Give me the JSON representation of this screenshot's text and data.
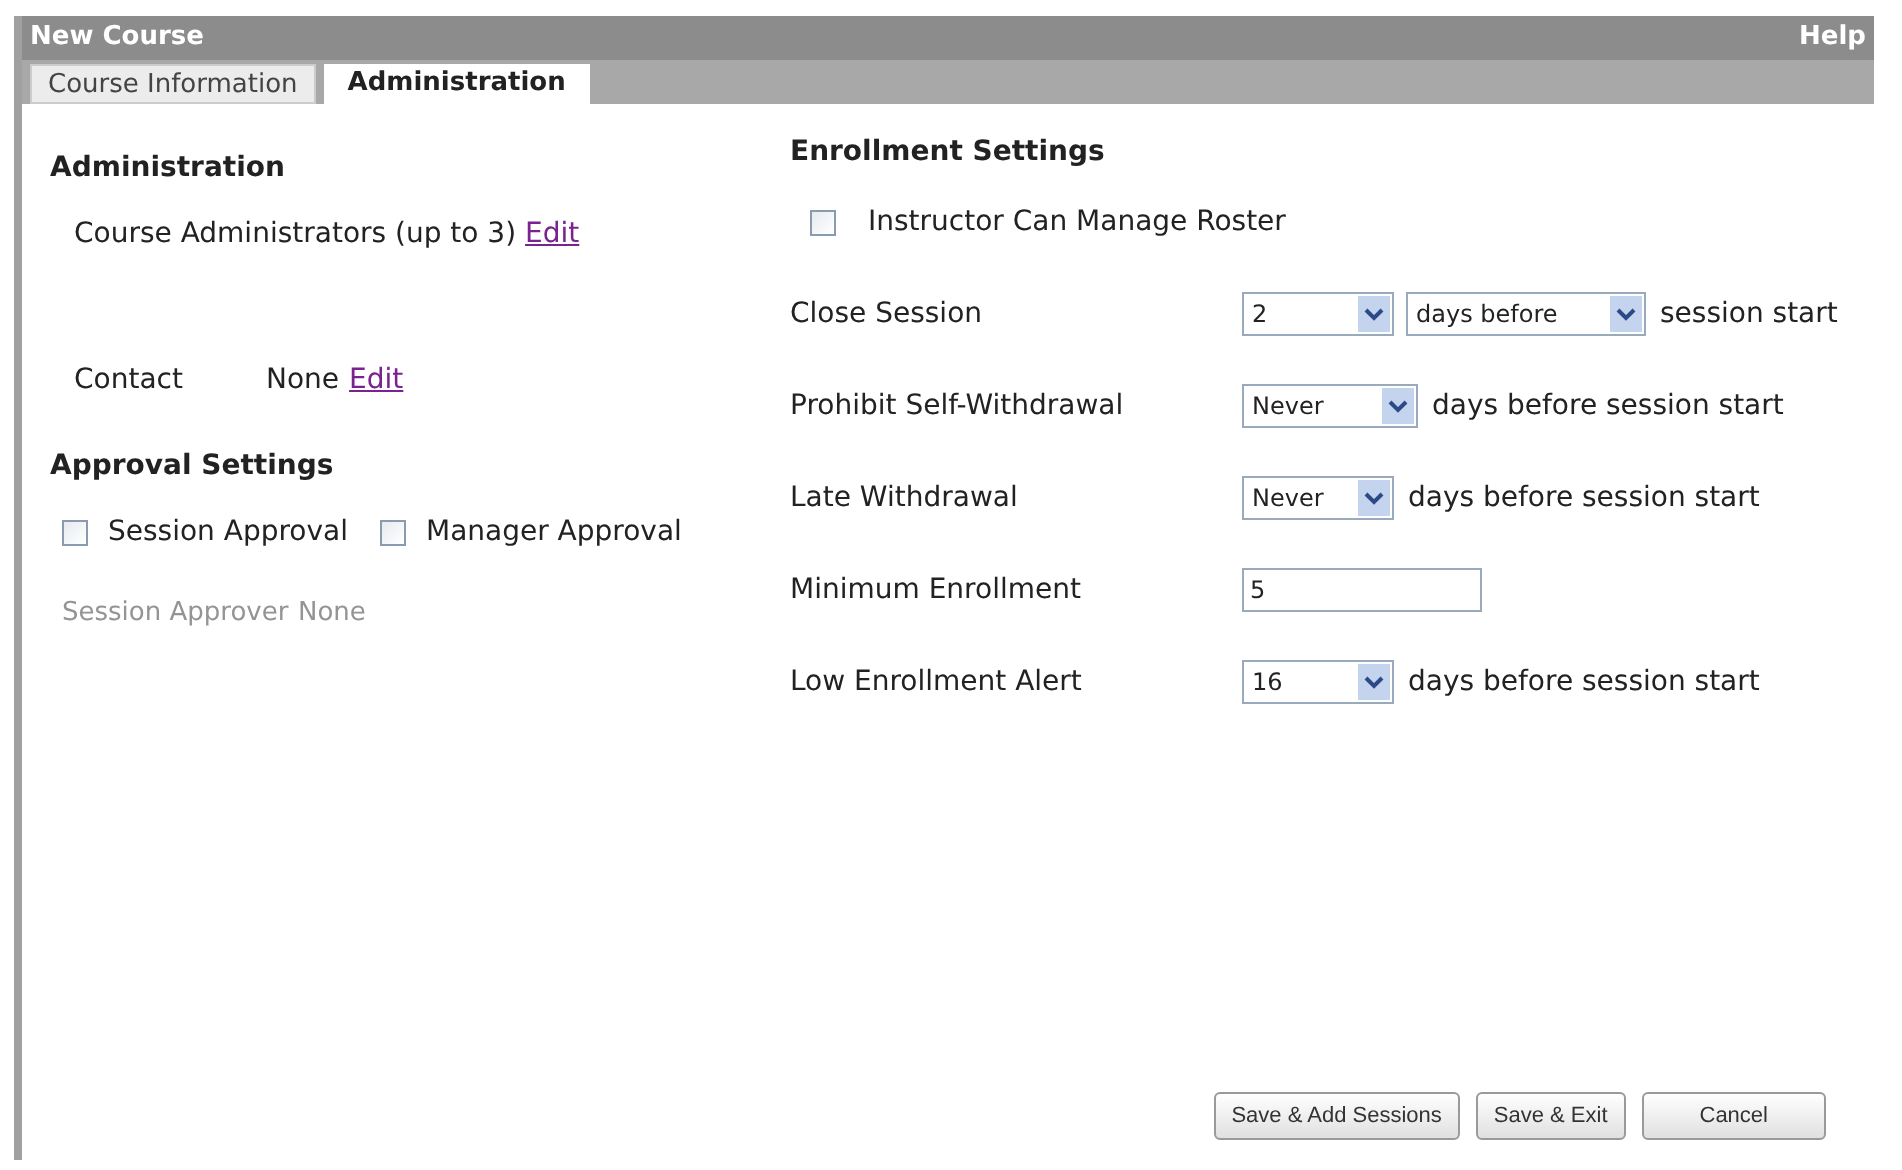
{
  "window": {
    "title": "New Course",
    "help": "Help"
  },
  "tabs": [
    {
      "label": "Course Information",
      "selected": false
    },
    {
      "label": "Administration",
      "selected": true
    }
  ],
  "administration": {
    "heading": "Administration",
    "administrators_label": "Course Administrators (up to 3)",
    "administrators_link": "Edit",
    "contact_label": "Contact",
    "contact_value": "None",
    "contact_link": "Edit"
  },
  "approval": {
    "heading": "Approval Settings",
    "options": [
      {
        "label": "Session Approval",
        "checked": false
      },
      {
        "label": "Manager Approval",
        "checked": false
      }
    ],
    "approver": {
      "label": "Session Approver",
      "value": "None",
      "disabled": true
    }
  },
  "enrollment": {
    "heading": "Enrollment Settings",
    "roster": {
      "label": "Instructor Can Manage Roster",
      "checked": false
    },
    "rows": [
      {
        "kind": "select",
        "label": "Close Session",
        "value": "2",
        "unit_select": "days before",
        "suffix": "session start"
      },
      {
        "kind": "select",
        "label": "Prohibit Self-Withdrawal",
        "value": "Never",
        "suffix": "days before session start"
      },
      {
        "kind": "select",
        "label": "Late Withdrawal",
        "value": "Never",
        "suffix": "days before session start"
      },
      {
        "kind": "input",
        "label": "Minimum Enrollment",
        "value": "5"
      },
      {
        "kind": "select",
        "label": "Low Enrollment Alert",
        "value": "16",
        "suffix": "days before session start"
      }
    ]
  },
  "buttons": [
    "Save & Add Sessions",
    "Save & Exit",
    "Cancel"
  ]
}
